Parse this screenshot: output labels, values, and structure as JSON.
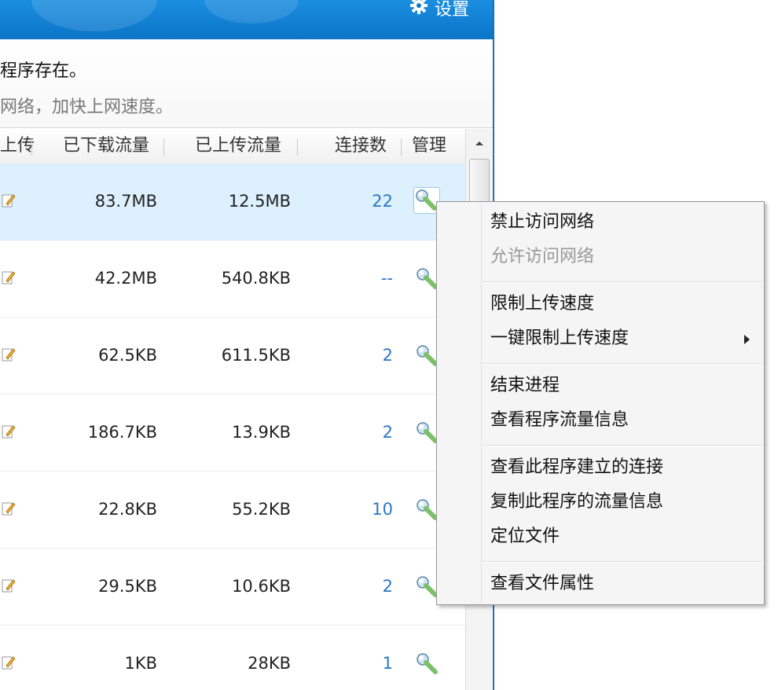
{
  "header": {
    "settings_label": "设置"
  },
  "info": {
    "line1": "程序存在。",
    "line2": "网络，加快上网速度。"
  },
  "table": {
    "columns": {
      "upload_truncated": "上传",
      "downloaded": "已下载流量",
      "uploaded": "已上传流量",
      "connections": "连接数",
      "manage": "管理"
    },
    "rows": [
      {
        "downloaded": "83.7MB",
        "uploaded": "12.5MB",
        "connections": "22"
      },
      {
        "downloaded": "42.2MB",
        "uploaded": "540.8KB",
        "connections": "--"
      },
      {
        "downloaded": "62.5KB",
        "uploaded": "611.5KB",
        "connections": "2"
      },
      {
        "downloaded": "186.7KB",
        "uploaded": "13.9KB",
        "connections": "2"
      },
      {
        "downloaded": "22.8KB",
        "uploaded": "55.2KB",
        "connections": "10"
      },
      {
        "downloaded": "29.5KB",
        "uploaded": "10.6KB",
        "connections": "2"
      },
      {
        "downloaded": "1KB",
        "uploaded": "28KB",
        "connections": "1"
      }
    ]
  },
  "context_menu": {
    "items": [
      {
        "label": "禁止访问网络",
        "enabled": true
      },
      {
        "label": "允许访问网络",
        "enabled": false
      },
      {
        "label": "限制上传速度",
        "enabled": true
      },
      {
        "label": "一键限制上传速度",
        "enabled": true,
        "has_submenu": true
      },
      {
        "label": "结束进程",
        "enabled": true
      },
      {
        "label": "查看程序流量信息",
        "enabled": true
      },
      {
        "label": "查看此程序建立的连接",
        "enabled": true
      },
      {
        "label": "复制此程序的流量信息",
        "enabled": true
      },
      {
        "label": "定位文件",
        "enabled": true
      },
      {
        "label": "查看文件属性",
        "enabled": true
      }
    ]
  },
  "colors": {
    "title_bar": "#0a74c8",
    "selected_row": "#ddf0fd",
    "connection_count": "#2a76c4",
    "wrench": "#7cc16a"
  }
}
